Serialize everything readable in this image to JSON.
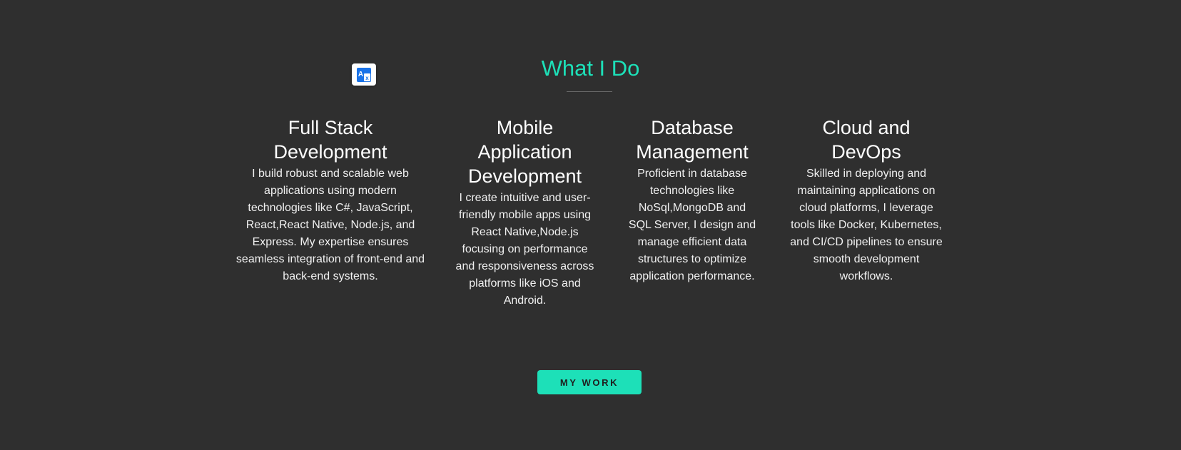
{
  "section": {
    "title": "What I Do"
  },
  "translate_widget": {
    "icon": "translate-icon"
  },
  "services": [
    {
      "title": "Full Stack Development",
      "description": "I build robust and scalable web applications using modern technologies like C#, JavaScript, React,React Native, Node.js, and Express. My expertise ensures seamless integration of front-end and back-end systems."
    },
    {
      "title": "Mobile Application Development",
      "description": "I create intuitive and user-friendly mobile apps using React Native,Node.js focusing on performance and responsiveness across platforms like iOS and Android."
    },
    {
      "title": "Database Management",
      "description": "Proficient in database technologies like NoSql,MongoDB and SQL Server, I design and manage efficient data structures to optimize application performance."
    },
    {
      "title": "Cloud and DevOps",
      "description": "Skilled in deploying and maintaining applications on cloud platforms, I leverage tools like Docker, Kubernetes, and CI/CD pipelines to ensure smooth development workflows."
    }
  ],
  "cta": {
    "label": "MY WORK"
  },
  "colors": {
    "background": "#2f2f2f",
    "accent": "#1de0b8",
    "text": "#ffffff"
  }
}
